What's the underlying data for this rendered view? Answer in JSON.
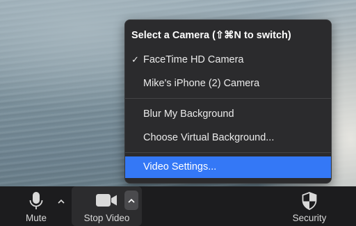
{
  "camera_menu": {
    "title": "Select a Camera (⇧⌘N to switch)",
    "items": [
      {
        "label": "FaceTime HD Camera",
        "checked": true
      },
      {
        "label": "Mike's iPhone (2) Camera",
        "checked": false
      },
      {
        "label": "Blur My Background",
        "checked": false
      },
      {
        "label": "Choose Virtual Background...",
        "checked": false
      },
      {
        "label": "Video Settings...",
        "checked": false,
        "highlighted": true
      }
    ],
    "check_mark": "✓"
  },
  "toolbar": {
    "mute_label": "Mute",
    "stop_video_label": "Stop Video",
    "security_label": "Security"
  },
  "colors": {
    "menu_background": "#2b2b2d",
    "highlight": "#3478f6",
    "toolbar_background": "#1c1c1e"
  }
}
